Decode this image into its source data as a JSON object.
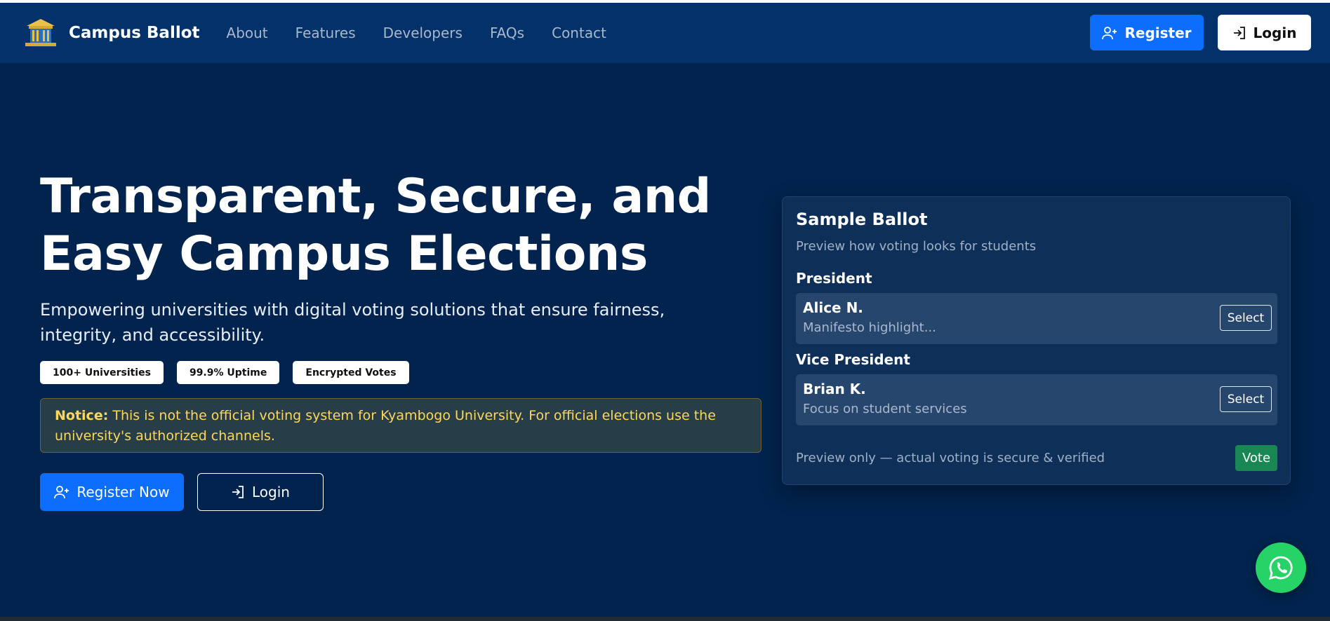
{
  "brand": {
    "name": "Campus Ballot",
    "logo_icon": "building-logo-icon"
  },
  "nav": {
    "links": [
      "About",
      "Features",
      "Developers",
      "FAQs",
      "Contact"
    ],
    "register_label": "Register",
    "login_label": "Login"
  },
  "hero": {
    "title_line1": "Transparent, Secure, and",
    "title_line2": "Easy Campus Elections",
    "subtitle": "Empowering universities with digital voting solutions that ensure fairness, integrity, and accessibility.",
    "stats": [
      "100+ Universities",
      "99.9% Uptime",
      "Encrypted Votes"
    ],
    "notice_label": "Notice:",
    "notice_text": " This is not the official voting system for Kyambogo University. For official elections use the university's authorized channels.",
    "register_now_label": "Register Now",
    "login_label": "Login"
  },
  "ballot": {
    "title": "Sample Ballot",
    "subtitle": "Preview how voting looks for students",
    "positions": [
      {
        "label": "President",
        "candidate": "Alice N.",
        "description": "Manifesto highlight...",
        "select_label": "Select"
      },
      {
        "label": "Vice President",
        "candidate": "Brian K.",
        "description": "Focus on student services",
        "select_label": "Select"
      }
    ],
    "footer_text": "Preview only — actual voting is secure & verified",
    "vote_label": "Vote"
  },
  "colors": {
    "background": "#02234d",
    "navbar": "#03326a",
    "primary": "#0d6efd",
    "success": "#198754",
    "notice_text": "#ffd75a",
    "whatsapp": "#25d366"
  },
  "fab": {
    "icon": "whatsapp-icon"
  }
}
